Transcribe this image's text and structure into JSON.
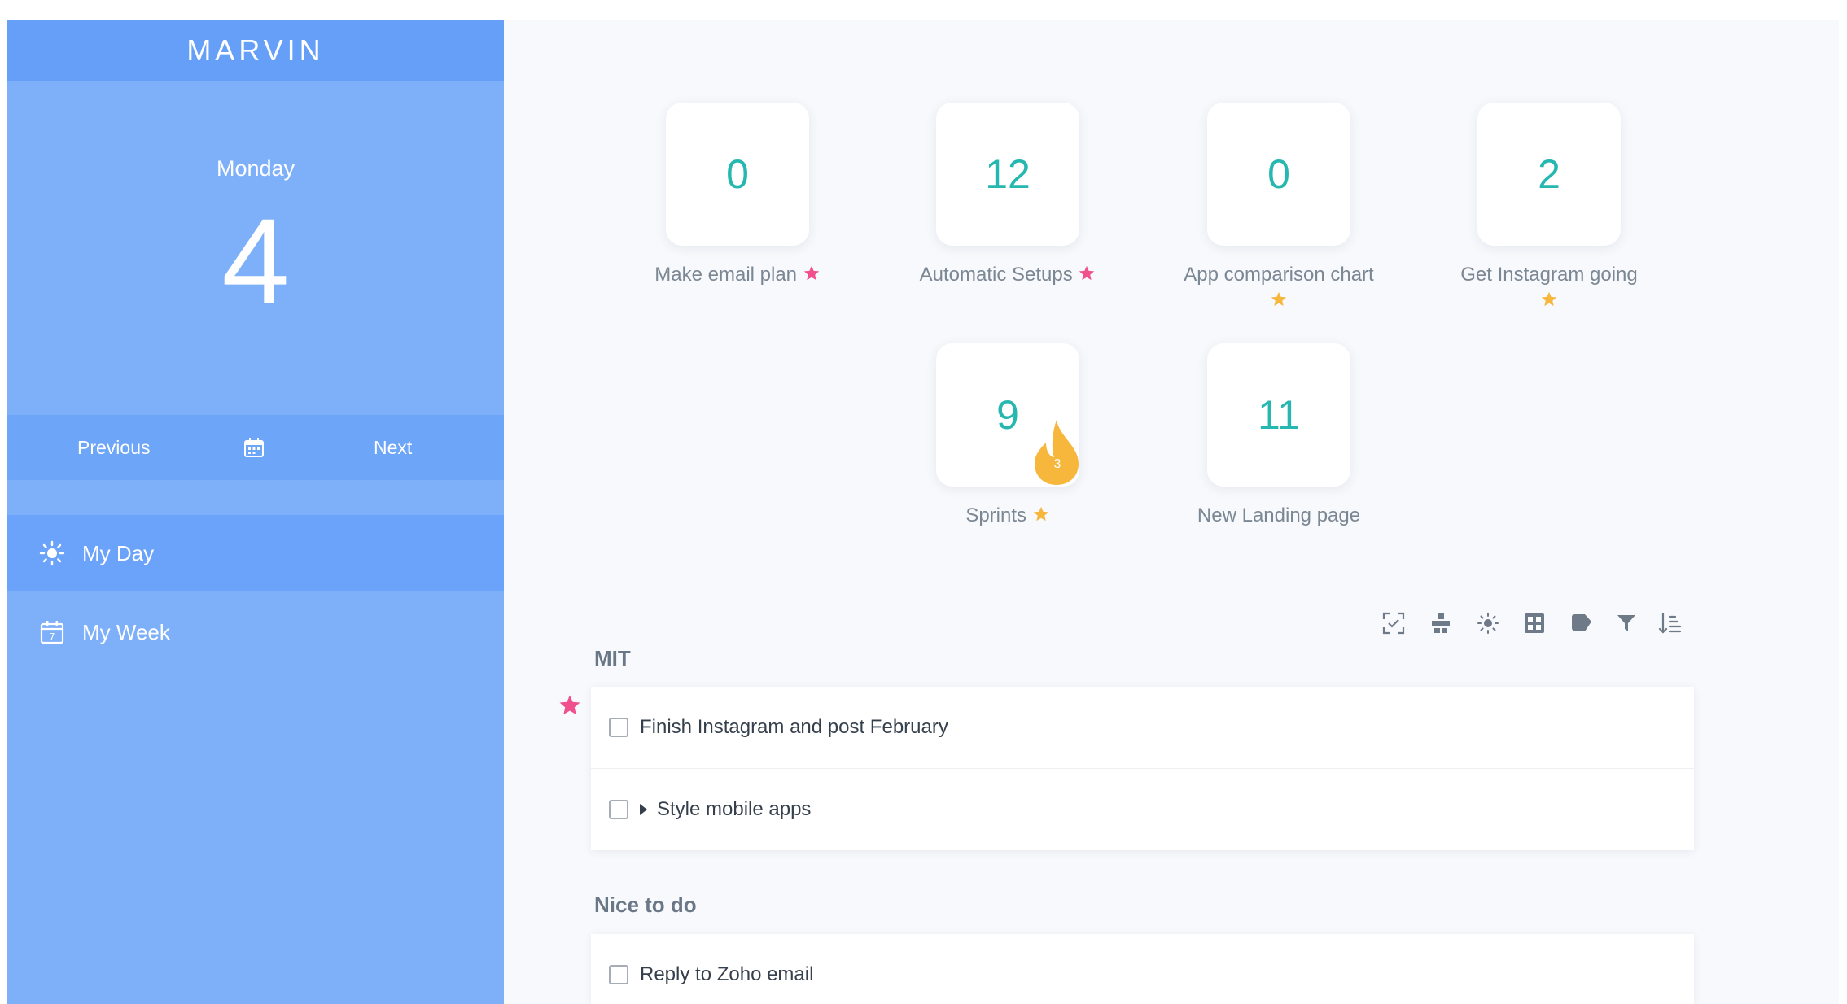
{
  "app": {
    "brand": "MARVIN"
  },
  "sidebar": {
    "day_name": "Monday",
    "day_number": "4",
    "nav": {
      "previous": "Previous",
      "next": "Next"
    },
    "items": [
      {
        "label": "My Day",
        "icon": "sun-icon",
        "active": true
      },
      {
        "label": "My Week",
        "icon": "calendar-week-icon",
        "active": false
      }
    ]
  },
  "projects": [
    {
      "count": "0",
      "label": "Make email plan",
      "star_color": "#f0508e"
    },
    {
      "count": "12",
      "label": "Automatic Setups",
      "star_color": "#f0508e"
    },
    {
      "count": "0",
      "label": "App comparison chart",
      "star_color": "#f6b73c"
    },
    {
      "count": "2",
      "label": "Get Instagram going",
      "star_color": "#f6b73c"
    },
    {
      "count": "9",
      "label": "Sprints",
      "star_color": "#f6b73c",
      "streak": "3"
    },
    {
      "count": "11",
      "label": "New Landing page"
    }
  ],
  "toolbar": {
    "icons": [
      "focus-icon",
      "blocks-icon",
      "sun-icon",
      "grid-icon",
      "tag-icon",
      "filter-icon",
      "sort-icon"
    ]
  },
  "sections": [
    {
      "title": "MIT",
      "tasks": [
        {
          "text": "Finish Instagram and post February",
          "starred": true
        },
        {
          "text": "Style mobile apps",
          "expandable": true
        }
      ]
    },
    {
      "title": "Nice to do",
      "tasks": [
        {
          "text": "Reply to Zoho email"
        }
      ]
    }
  ],
  "colors": {
    "sidebar": "#7eb0fa",
    "accent_teal": "#26b8b0",
    "star_pink": "#f0508e",
    "star_orange": "#f6b73c"
  }
}
